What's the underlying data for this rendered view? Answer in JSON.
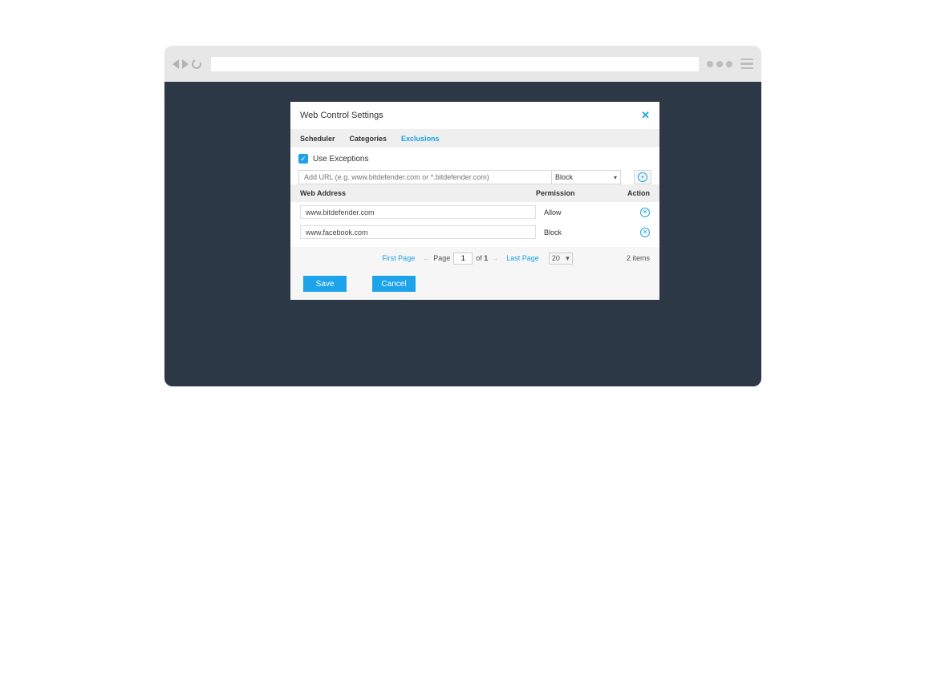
{
  "modal": {
    "title": "Web Control Settings",
    "tabs": [
      "Scheduler",
      "Categories",
      "Exclusions"
    ],
    "active_tab": "Exclusions"
  },
  "exclusions": {
    "checkbox_label": "Use Exceptions",
    "checkbox_checked": true,
    "url_placeholder": "Add URL (e.g. www.bitdefender.com or *.bitdefender.com)",
    "permission_default": "Block",
    "columns": {
      "address": "Web Address",
      "permission": "Permission",
      "action": "Action"
    },
    "rows": [
      {
        "address": "www.bitdefender.com",
        "permission": "Allow"
      },
      {
        "address": "www.facebook.com",
        "permission": "Block"
      }
    ]
  },
  "pager": {
    "first": "First Page",
    "page_label": "Page",
    "page_value": "1",
    "of_label": "of",
    "total_pages": "1",
    "last": "Last Page",
    "per_page": "20",
    "items_text": "2 items"
  },
  "buttons": {
    "save": "Save",
    "cancel": "Cancel"
  }
}
